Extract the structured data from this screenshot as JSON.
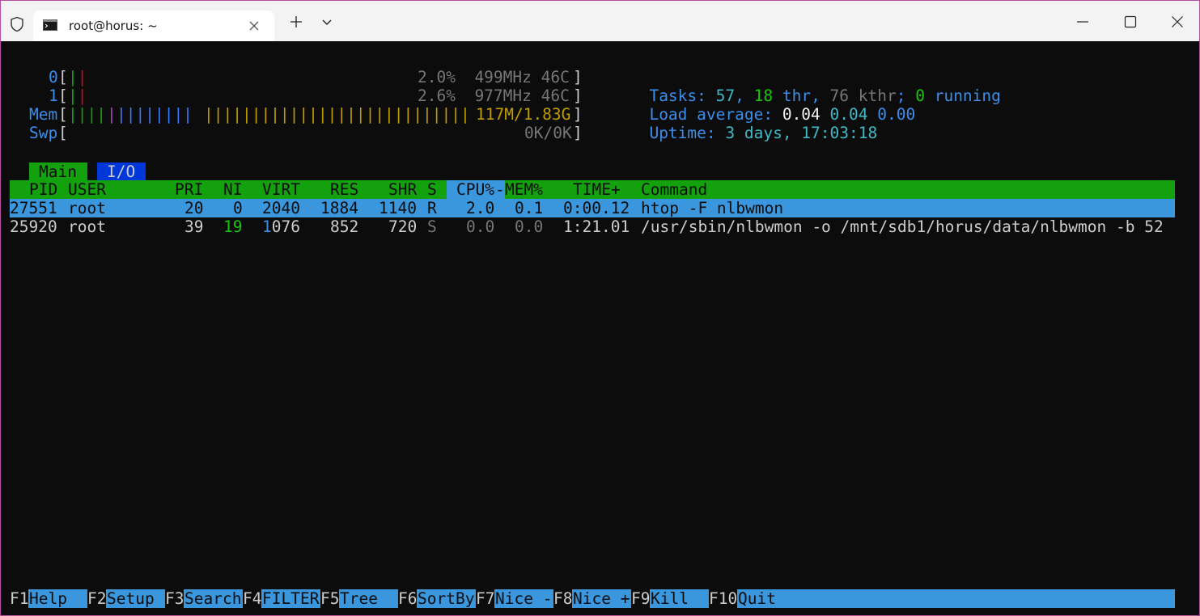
{
  "window": {
    "tab_title": "root@horus: ~",
    "icons": [
      "shield-icon",
      "terminal-icon",
      "close-icon",
      "plus-icon",
      "chevron-down-icon",
      "minimize-icon",
      "maximize-icon",
      "window-close-icon"
    ]
  },
  "meters": {
    "cpu0": {
      "label": "0",
      "bracket_open": "[",
      "bars": "||",
      "value": "2.0%  499MHz 46C",
      "bracket_close": "]"
    },
    "cpu1": {
      "label": "1",
      "bracket_open": "[",
      "bars": "||",
      "value": "2.6%  977MHz 46C",
      "bracket_close": "]"
    },
    "mem": {
      "label": "Mem",
      "bracket_open": "[",
      "bars_green": "||||",
      "bars_mag": "|",
      "bars_blue": "||||||||",
      "bars_gold": "||||||||||||||||||||||||||||",
      "value": "117M/1.83G",
      "bracket_close": "]"
    },
    "swp": {
      "label": "Swp",
      "bracket_open": "[",
      "value": "0K/0K",
      "bracket_close": "]"
    }
  },
  "summary": {
    "tasks_label": "Tasks: ",
    "tasks": "57",
    "comma1": ", ",
    "thr": "18",
    "thr_label": " thr",
    "comma2": ", ",
    "kthr": "76 kthr",
    "semi": "; ",
    "running": "0",
    "running_label": " running",
    "load_label": "Load average: ",
    "load1": "0.04",
    "load5": "0.04",
    "load15": "0.00",
    "uptime_label": "Uptime: ",
    "uptime": "3 days, 17:03:18"
  },
  "tabs": {
    "main": "Main",
    "io": "I/O"
  },
  "header": {
    "pid": "PID",
    "user": "USER",
    "pri": "PRI",
    "ni": "NI",
    "virt": "VIRT",
    "res": "RES",
    "shr": "SHR",
    "s": "S",
    "cpu": "CPU%",
    "mem_sep": "-",
    "mem": "MEM%",
    "time": "TIME+",
    "command": "Command"
  },
  "processes": [
    {
      "pid": "27551",
      "user": "root",
      "pri": "20",
      "ni": "0",
      "virt": "2040",
      "res": "1884",
      "shr": "1140",
      "s": "R",
      "cpu": "2.0",
      "mem": "0.1",
      "time": "0:00.12",
      "command": "htop -F nlbwmon"
    },
    {
      "pid": "25920",
      "user": "root",
      "pri": "39",
      "ni": "19",
      "virt_hi": "1",
      "virt": "076",
      "res": "852",
      "shr": "720",
      "s": "S",
      "cpu": "0.0",
      "mem": "0.0",
      "time": "1:21.01",
      "command": "/usr/sbin/nlbwmon -o /mnt/sdb1/horus/data/nlbwmon -b 52"
    }
  ],
  "footer": [
    {
      "key": "F1",
      "label": "Help  "
    },
    {
      "key": "F2",
      "label": "Setup "
    },
    {
      "key": "F3",
      "label": "Search"
    },
    {
      "key": "F4",
      "label": "FILTER"
    },
    {
      "key": "F5",
      "label": "Tree  "
    },
    {
      "key": "F6",
      "label": "SortBy"
    },
    {
      "key": "F7",
      "label": "Nice -"
    },
    {
      "key": "F8",
      "label": "Nice +"
    },
    {
      "key": "F9",
      "label": "Kill  "
    },
    {
      "key": "F10",
      "label": "Quit"
    }
  ],
  "colors": {
    "accent": "#3a96dd",
    "green": "#13a10e",
    "frame": "#b64fa1"
  }
}
